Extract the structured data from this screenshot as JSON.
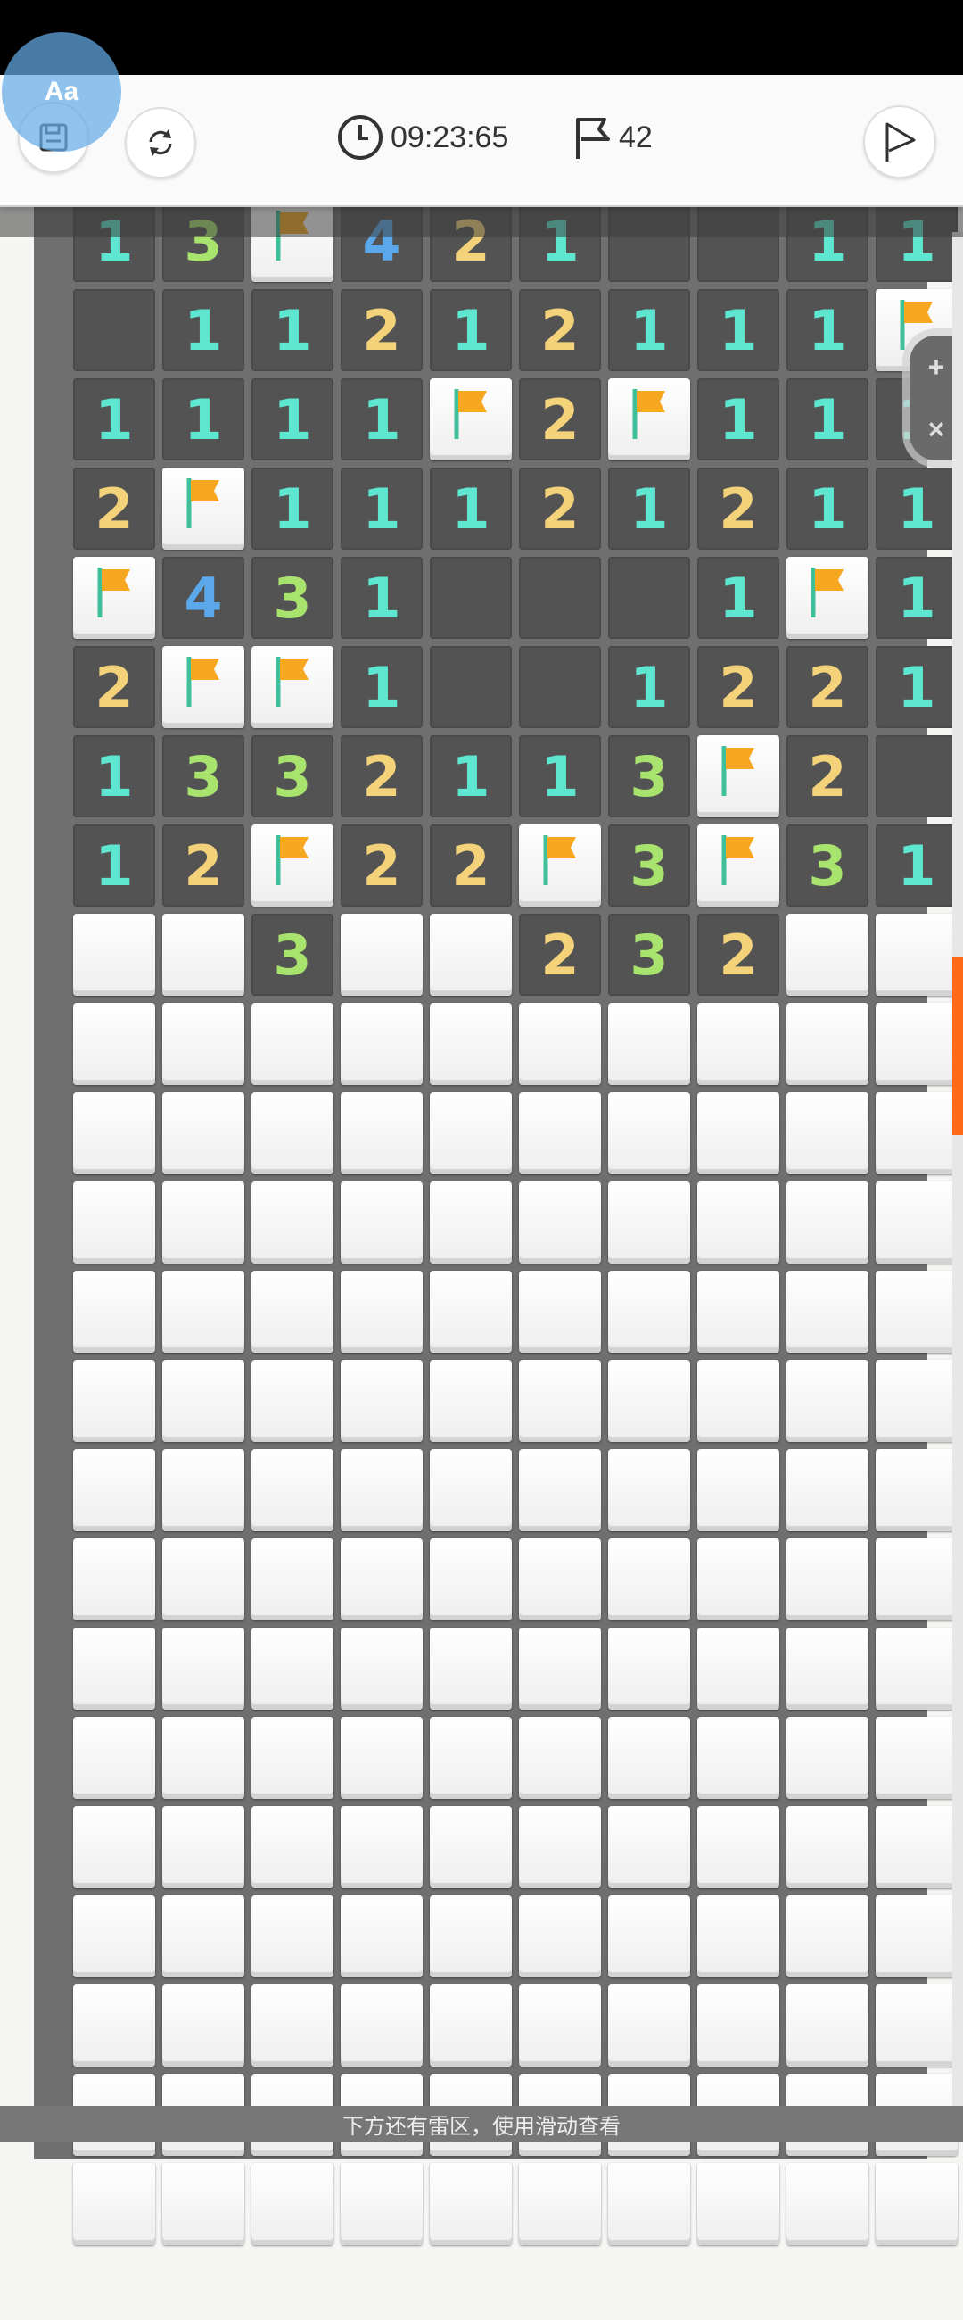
{
  "header": {
    "timer": "09:23:65",
    "flags_left": "42",
    "overlay_label": "Aa",
    "icons": [
      "save-icon",
      "refresh-icon",
      "clock-icon",
      "flag-outline-icon",
      "flag-play-icon"
    ]
  },
  "colors": {
    "n1": "#5ee6d0",
    "n2": "#f3d27a",
    "n3": "#a8e36d",
    "n4": "#5aa8ea",
    "revealed": "#535353",
    "flag": "#f6a820",
    "scroll_thumb": "#ff6a1a"
  },
  "zoom": {
    "plus": "+",
    "close": "×"
  },
  "board": {
    "cols": 10,
    "rows": [
      [
        "1",
        "3",
        "F",
        "4",
        "2",
        "1",
        "",
        "",
        "1",
        "1"
      ],
      [
        "",
        "1",
        "1",
        "2",
        "1",
        "2",
        "1",
        "1",
        "1",
        "F"
      ],
      [
        "1",
        "1",
        "1",
        "1",
        "F",
        "2",
        "F",
        "1",
        "1",
        "1"
      ],
      [
        "2",
        "F",
        "1",
        "1",
        "1",
        "2",
        "1",
        "2",
        "1",
        "1"
      ],
      [
        "F",
        "4",
        "3",
        "1",
        "",
        "",
        "",
        "1",
        "F",
        "1"
      ],
      [
        "2",
        "F",
        "F",
        "1",
        "",
        "",
        "1",
        "2",
        "2",
        "1"
      ],
      [
        "1",
        "3",
        "3",
        "2",
        "1",
        "1",
        "3",
        "F",
        "2",
        ""
      ],
      [
        "1",
        "2",
        "F",
        "2",
        "2",
        "F",
        "3",
        "F",
        "3",
        "1"
      ],
      [
        "H",
        "H",
        "3",
        "H",
        "H",
        "2",
        "3",
        "2",
        "H",
        "H"
      ],
      [
        "H",
        "H",
        "H",
        "H",
        "H",
        "H",
        "H",
        "H",
        "H",
        "H"
      ],
      [
        "H",
        "H",
        "H",
        "H",
        "H",
        "H",
        "H",
        "H",
        "H",
        "H"
      ],
      [
        "H",
        "H",
        "H",
        "H",
        "H",
        "H",
        "H",
        "H",
        "H",
        "H"
      ],
      [
        "H",
        "H",
        "H",
        "H",
        "H",
        "H",
        "H",
        "H",
        "H",
        "H"
      ],
      [
        "H",
        "H",
        "H",
        "H",
        "H",
        "H",
        "H",
        "H",
        "H",
        "H"
      ],
      [
        "H",
        "H",
        "H",
        "H",
        "H",
        "H",
        "H",
        "H",
        "H",
        "H"
      ],
      [
        "H",
        "H",
        "H",
        "H",
        "H",
        "H",
        "H",
        "H",
        "H",
        "H"
      ],
      [
        "H",
        "H",
        "H",
        "H",
        "H",
        "H",
        "H",
        "H",
        "H",
        "H"
      ],
      [
        "H",
        "H",
        "H",
        "H",
        "H",
        "H",
        "H",
        "H",
        "H",
        "H"
      ],
      [
        "H",
        "H",
        "H",
        "H",
        "H",
        "H",
        "H",
        "H",
        "H",
        "H"
      ],
      [
        "H",
        "H",
        "H",
        "H",
        "H",
        "H",
        "H",
        "H",
        "H",
        "H"
      ],
      [
        "H",
        "H",
        "H",
        "H",
        "H",
        "H",
        "H",
        "H",
        "H",
        "H"
      ],
      [
        "H",
        "H",
        "H",
        "H",
        "H",
        "H",
        "H",
        "H",
        "H",
        "H"
      ],
      [
        "H",
        "H",
        "H",
        "H",
        "H",
        "H",
        "H",
        "H",
        "H",
        "H"
      ]
    ]
  },
  "footer": {
    "hint": "下方还有雷区，使用滑动查看"
  }
}
